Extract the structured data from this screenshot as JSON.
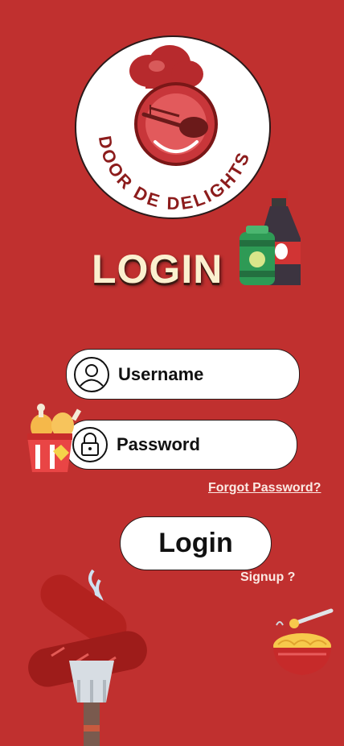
{
  "brand": {
    "name": "DOOR DE DELIGHTS"
  },
  "title": "LOGIN",
  "form": {
    "username_placeholder": "Username",
    "password_placeholder": "Password",
    "forgot_label": "Forgot Password?",
    "login_label": "Login",
    "signup_label": "Signup ?"
  },
  "colors": {
    "background": "#c0302f",
    "title_text": "#fbf0cf",
    "field_bg": "#ffffff"
  },
  "icons": [
    "user-icon",
    "lock-icon",
    "soda-icon",
    "fried-chicken-icon",
    "sausage-icon",
    "noodles-icon",
    "chef-hat-icon"
  ]
}
